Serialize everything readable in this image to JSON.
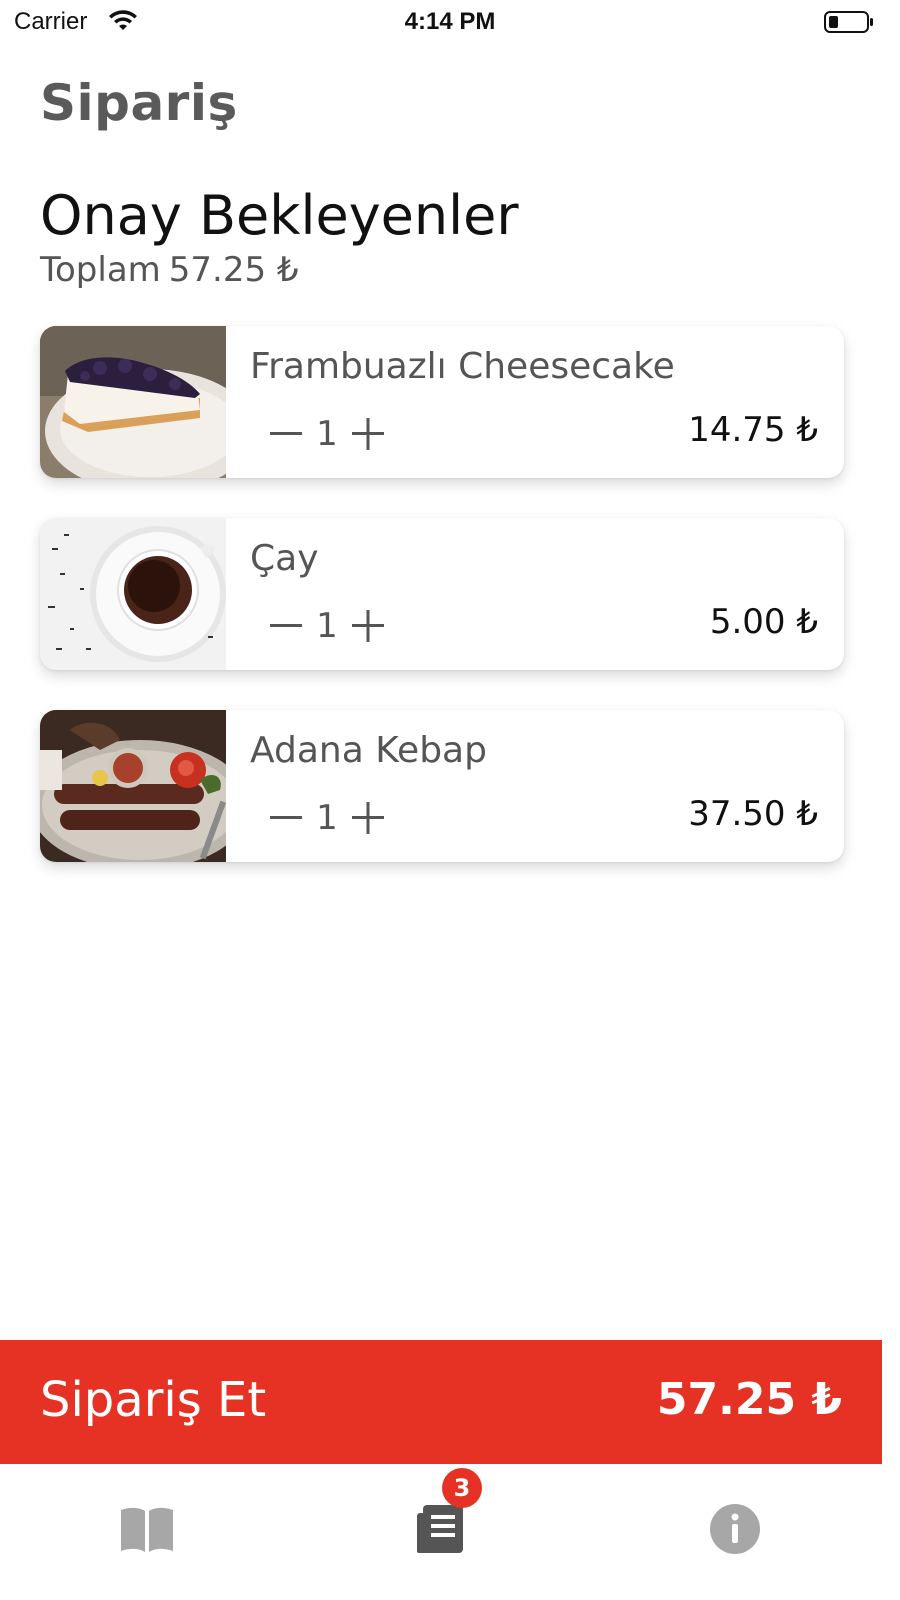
{
  "status_bar": {
    "carrier": "Carrier",
    "time": "4:14 PM"
  },
  "header": {
    "title": "Sipariş"
  },
  "pending": {
    "title": "Onay Bekleyenler",
    "total_label": "Toplam",
    "total_value": "57.25 ₺"
  },
  "items": [
    {
      "name": "Frambuazlı Cheesecake",
      "quantity": "1",
      "price": "14.75 ₺",
      "image": "cheesecake-photo"
    },
    {
      "name": "Çay",
      "quantity": "1",
      "price": "5.00 ₺",
      "image": "tea-cup-photo"
    },
    {
      "name": "Adana Kebap",
      "quantity": "1",
      "price": "37.50 ₺",
      "image": "adana-kebap-photo"
    }
  ],
  "order_bar": {
    "label": "Sipariş Et",
    "total": "57.25 ₺"
  },
  "tab_bar": {
    "tabs": [
      {
        "icon": "menu-book-icon",
        "active": false
      },
      {
        "icon": "order-list-icon",
        "active": true,
        "badge": "3"
      },
      {
        "icon": "info-icon",
        "active": false
      }
    ]
  },
  "colors": {
    "accent": "#e53224",
    "title_gray": "#5a5a5a",
    "tab_inactive": "#a7a7a7",
    "tab_active": "#555555"
  }
}
